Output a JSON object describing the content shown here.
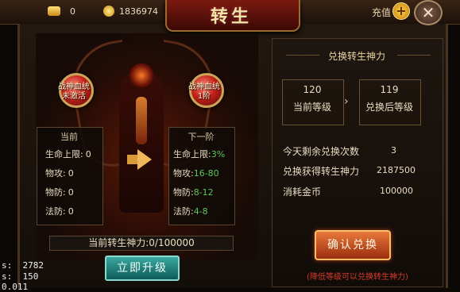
{
  "top_bar": {
    "ingot_count": "0",
    "coin_count": "1836974",
    "recharge_label": "充值",
    "plus_icon": "plus-icon",
    "close_icon": "close-icon"
  },
  "title": "转生",
  "left": {
    "current_orb": "战神血统\n未激活",
    "next_orb": "战神血统\n1阶",
    "current": {
      "header": "当前",
      "rows": [
        {
          "label": "生命上限:",
          "value": "0"
        },
        {
          "label": "物攻:",
          "value": "0"
        },
        {
          "label": "物防:",
          "value": "0"
        },
        {
          "label": "法防:",
          "value": "0"
        }
      ]
    },
    "next": {
      "header": "下一阶",
      "rows": [
        {
          "label": "生命上限:",
          "value": "3%"
        },
        {
          "label": "物攻:",
          "value": "16-80"
        },
        {
          "label": "物防:",
          "value": "8-12"
        },
        {
          "label": "法防:",
          "value": "4-8"
        }
      ]
    },
    "power_text": "当前转生神力:0/100000",
    "upgrade_button": "立即升级"
  },
  "right": {
    "title": "兑换转生神力",
    "current_level": "120",
    "current_level_label": "当前等级",
    "after_level": "119",
    "after_level_label": "兑换后等级",
    "info": [
      {
        "label": "今天剩余兑换次数",
        "value": "3"
      },
      {
        "label": "兑换获得转生神力",
        "value": "2187500"
      },
      {
        "label": "消耗金币",
        "value": "100000"
      }
    ],
    "confirm_button": "确认兑换",
    "note": "(降低等级可以兑换转生神力)"
  },
  "debug": {
    "line1": "s:  2782",
    "line2": "s:  150",
    "line3": "0.011"
  },
  "colors": {
    "green_value": "#5ac85a",
    "accent_gold": "#c9a45a",
    "note_red": "#d83a2a"
  }
}
